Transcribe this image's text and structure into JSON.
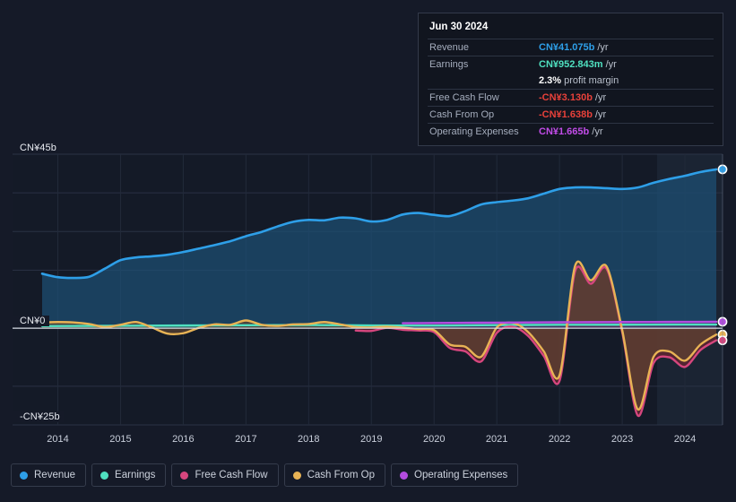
{
  "chart_data": {
    "type": "area",
    "title": "",
    "xlabel": "",
    "ylabel": "",
    "currency": "CN¥",
    "grid": true,
    "legend_position": "bottom",
    "ylim": [
      -25,
      45
    ],
    "y_ticks": [
      {
        "value": 45,
        "label": "CN¥45b"
      },
      {
        "value": 0,
        "label": "CN¥0"
      },
      {
        "value": -25,
        "label": "-CN¥25b"
      }
    ],
    "x_ticks": [
      "2014",
      "2015",
      "2016",
      "2017",
      "2018",
      "2019",
      "2020",
      "2021",
      "2022",
      "2023",
      "2024"
    ],
    "xlim": [
      2013.75,
      2024.6
    ],
    "series": [
      {
        "name": "Revenue",
        "color": "#2e9fe8",
        "fill": "#1d4f75",
        "x": [
          2013.75,
          2014.0,
          2014.25,
          2014.5,
          2014.75,
          2015.0,
          2015.25,
          2015.5,
          2015.75,
          2016.0,
          2016.25,
          2016.5,
          2016.75,
          2017.0,
          2017.25,
          2017.5,
          2017.75,
          2018.0,
          2018.25,
          2018.5,
          2018.75,
          2019.0,
          2019.25,
          2019.5,
          2019.75,
          2020.0,
          2020.25,
          2020.5,
          2020.75,
          2021.0,
          2021.25,
          2021.5,
          2021.75,
          2022.0,
          2022.25,
          2022.5,
          2022.75,
          2023.0,
          2023.25,
          2023.5,
          2023.75,
          2024.0,
          2024.25,
          2024.5
        ],
        "values": [
          14.1,
          13.2,
          13.0,
          13.3,
          15.4,
          17.6,
          18.3,
          18.6,
          19.0,
          19.7,
          20.6,
          21.5,
          22.5,
          23.8,
          24.9,
          26.3,
          27.5,
          28.0,
          27.9,
          28.6,
          28.4,
          27.6,
          28.0,
          29.4,
          29.8,
          29.3,
          29.0,
          30.3,
          32.0,
          32.6,
          33.0,
          33.6,
          34.8,
          36.0,
          36.4,
          36.4,
          36.2,
          36.0,
          36.4,
          37.6,
          38.6,
          39.4,
          40.4,
          41.075
        ]
      },
      {
        "name": "Earnings",
        "color": "#4fe0c0",
        "fill": "#2a5a52",
        "x": [
          2013.75,
          2015.0,
          2016.0,
          2017.0,
          2018.0,
          2019.0,
          2020.0,
          2021.0,
          2022.0,
          2023.0,
          2024.0,
          2024.5
        ],
        "values": [
          0.55,
          0.62,
          0.7,
          0.78,
          0.82,
          0.72,
          0.68,
          0.8,
          0.88,
          0.9,
          0.94,
          0.952843
        ]
      },
      {
        "name": "Free Cash Flow",
        "color": "#d6467e",
        "fill": "#6b2430",
        "x": [
          2018.75,
          2019.0,
          2019.25,
          2019.5,
          2019.75,
          2020.0,
          2020.25,
          2020.5,
          2020.75,
          2021.0,
          2021.25,
          2021.5,
          2021.75,
          2022.0,
          2022.25,
          2022.5,
          2022.75,
          2023.0,
          2023.25,
          2023.5,
          2023.75,
          2024.0,
          2024.25,
          2024.5
        ],
        "values": [
          -0.6,
          -0.7,
          0.1,
          -0.4,
          -0.6,
          -1.0,
          -5.1,
          -6.0,
          -8.6,
          -1.2,
          0.4,
          -2.0,
          -7.2,
          -13.6,
          14.8,
          11.5,
          15.4,
          -1.0,
          -22.6,
          -9.0,
          -7.5,
          -10.0,
          -5.6,
          -3.13
        ]
      },
      {
        "name": "Cash From Op",
        "color": "#e8b355",
        "fill": "#5c4332",
        "x": [
          2013.75,
          2014.0,
          2014.25,
          2014.5,
          2014.75,
          2015.0,
          2015.25,
          2015.5,
          2015.75,
          2016.0,
          2016.25,
          2016.5,
          2016.75,
          2017.0,
          2017.25,
          2017.5,
          2017.75,
          2018.0,
          2018.25,
          2018.5,
          2018.75,
          2019.0,
          2019.25,
          2019.5,
          2019.75,
          2020.0,
          2020.25,
          2020.5,
          2020.75,
          2021.0,
          2021.25,
          2021.5,
          2021.75,
          2022.0,
          2022.25,
          2022.5,
          2022.75,
          2023.0,
          2023.25,
          2023.5,
          2023.75,
          2024.0,
          2024.25,
          2024.5
        ],
        "values": [
          1.5,
          1.6,
          1.5,
          1.1,
          0.3,
          0.9,
          1.6,
          0.2,
          -1.4,
          -1.3,
          0.1,
          1.0,
          0.9,
          2.0,
          0.9,
          0.6,
          1.0,
          1.1,
          1.6,
          1.0,
          0.3,
          0.2,
          0.4,
          0.1,
          -0.2,
          -0.5,
          -4.2,
          -4.8,
          -7.4,
          0.2,
          1.4,
          -1.0,
          -6.0,
          -12.2,
          16.2,
          12.4,
          16.0,
          -0.5,
          -21.0,
          -7.4,
          -6.0,
          -8.4,
          -4.2,
          -1.638
        ]
      },
      {
        "name": "Operating Expenses",
        "color": "#b44ce0",
        "fill": "#4a2a66",
        "x": [
          2019.5,
          2020.0,
          2020.5,
          2021.0,
          2021.5,
          2022.0,
          2022.5,
          2023.0,
          2023.5,
          2024.0,
          2024.5
        ],
        "values": [
          1.3,
          1.34,
          1.4,
          1.45,
          1.5,
          1.54,
          1.57,
          1.6,
          1.62,
          1.64,
          1.665
        ]
      }
    ],
    "endpoint_markers": [
      {
        "series": "Revenue",
        "value": 41.075,
        "color": "#2e9fe8"
      },
      {
        "series": "Operating Expenses",
        "value": 1.665,
        "color": "#b44ce0"
      },
      {
        "series": "Cash From Op",
        "value": -1.638,
        "color": "#e8b355"
      },
      {
        "series": "Free Cash Flow",
        "value": -3.13,
        "color": "#d6467e"
      }
    ]
  },
  "tooltip": {
    "date": "Jun 30 2024",
    "rows": [
      {
        "key": "Revenue",
        "value": "CN¥41.075b",
        "unit": "/yr",
        "color": "#2e9fe8"
      },
      {
        "key": "Earnings",
        "value": "CN¥952.843m",
        "unit": "/yr",
        "color": "#4fe0c0"
      },
      {
        "key": "",
        "value": "2.3%",
        "unit": "profit margin",
        "color": "#ffffff"
      },
      {
        "key": "Free Cash Flow",
        "value": "-CN¥3.130b",
        "unit": "/yr",
        "color": "#e8413a"
      },
      {
        "key": "Cash From Op",
        "value": "-CN¥1.638b",
        "unit": "/yr",
        "color": "#e8413a"
      },
      {
        "key": "Operating Expenses",
        "value": "CN¥1.665b",
        "unit": "/yr",
        "color": "#c24ce8"
      }
    ]
  },
  "legend": {
    "items": [
      {
        "label": "Revenue",
        "color": "#2e9fe8"
      },
      {
        "label": "Earnings",
        "color": "#4fe0c0"
      },
      {
        "label": "Free Cash Flow",
        "color": "#d6467e"
      },
      {
        "label": "Cash From Op",
        "color": "#e8b355"
      },
      {
        "label": "Operating Expenses",
        "color": "#b44ce0"
      }
    ]
  }
}
